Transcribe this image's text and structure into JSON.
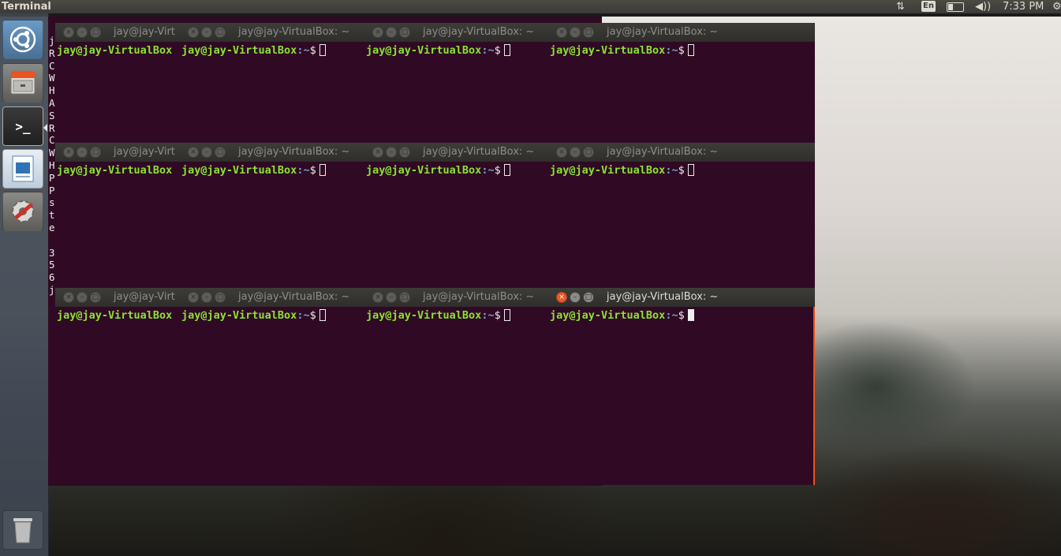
{
  "top_panel": {
    "active_app": "Terminal",
    "indicators": {
      "network_icon": "network-updown-icon",
      "language": "En",
      "battery_icon": "battery-icon",
      "sound_icon": "volume-icon",
      "sound_glyph": "◀))",
      "network_glyph": "⇅",
      "clock": "7:33 PM",
      "gear_icon": "gear-icon",
      "gear_glyph": "⚙"
    }
  },
  "launcher": {
    "items": [
      {
        "name": "dash",
        "icon": "ubuntu-logo-icon"
      },
      {
        "name": "files",
        "icon": "file-cabinet-icon"
      },
      {
        "name": "terminal",
        "icon": "terminal-icon",
        "glyph": ">_"
      },
      {
        "name": "writer",
        "icon": "document-writer-icon"
      },
      {
        "name": "system-settings",
        "icon": "settings-wrench-gear-icon"
      },
      {
        "name": "trash",
        "icon": "trash-icon"
      }
    ]
  },
  "background_column": [
    "j",
    "R",
    "C",
    "W",
    "H",
    "A",
    "S",
    "R",
    "C",
    "W",
    "H",
    "P",
    "P",
    "s",
    "t",
    "e",
    "",
    "3",
    "5",
    "6",
    "j"
  ],
  "terminals": {
    "title": "jay@jay-VirtualBox: ~",
    "title_truncated": "jay@jay-Virt",
    "prompt_user": "jay@jay-VirtualBox",
    "prompt_path": ":~",
    "prompt_dollar": "$",
    "focused_index": 11
  },
  "colors": {
    "terminal_bg": "#300a24",
    "prompt_user": "#8ae234",
    "prompt_path": "#729fcf",
    "accent": "#e95420"
  }
}
